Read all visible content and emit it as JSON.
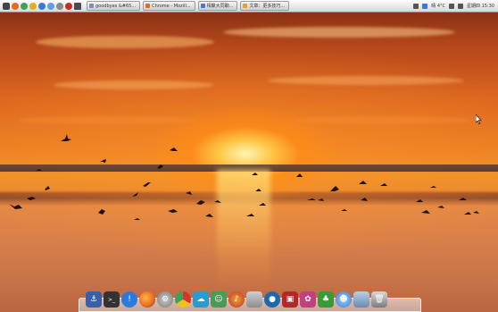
{
  "desktop": {
    "wallpaper": "sunset over sea with flying birds"
  },
  "top_panel": {
    "tasks": [
      {
        "label": "goodbyes &#65...",
        "color": "#7a8fb0"
      },
      {
        "label": "Chrome - Mozill...",
        "color": "#e86b1d"
      },
      {
        "label": "相聚大同聊...",
        "color": "#4a78c8"
      },
      {
        "label": "文章：更多技巧...",
        "color": "#e2a030"
      }
    ],
    "weather": "晴 4°C",
    "clock": "星期四 15:30"
  },
  "dock": {
    "items": [
      {
        "name": "anchor",
        "color": "#3a5fa8"
      },
      {
        "name": "terminal",
        "color": "#333333"
      },
      {
        "name": "info",
        "color": "#2a7ae0"
      },
      {
        "name": "firefox",
        "color": "#e86b1d"
      },
      {
        "name": "settings",
        "color": "#8a8a8a"
      },
      {
        "name": "chrome",
        "color": "#3aa35a"
      },
      {
        "name": "network",
        "color": "#2a9ad0"
      },
      {
        "name": "character",
        "color": "#4a9a5a"
      },
      {
        "name": "music",
        "color": "#c0302a"
      },
      {
        "name": "drive",
        "color": "#9a9aa0"
      },
      {
        "name": "qq",
        "color": "#1a6ab0"
      },
      {
        "name": "slideshow",
        "color": "#b02a2a"
      },
      {
        "name": "game",
        "color": "#c04080"
      },
      {
        "name": "users",
        "color": "#3a9a3a"
      },
      {
        "name": "finder",
        "color": "#3a7ad0"
      },
      {
        "name": "folder",
        "color": "#6a8ab0"
      },
      {
        "name": "trash",
        "color": "#7a7a80"
      }
    ]
  }
}
